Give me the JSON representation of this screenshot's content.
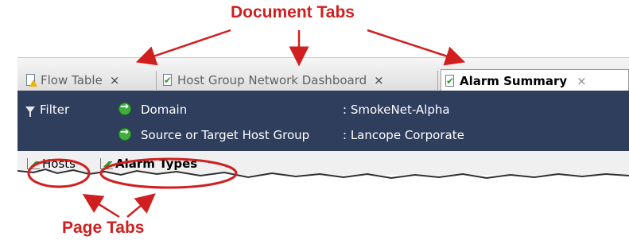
{
  "annotations": {
    "document_tabs": "Document Tabs",
    "page_tabs": "Page Tabs",
    "color": "#d01f1f"
  },
  "document_tabs": [
    {
      "label": "Flow Table",
      "icon": "document-warning-icon",
      "close": "×",
      "active": false
    },
    {
      "label": "Host Group Network Dashboard",
      "icon": "document-check-icon",
      "close": "×",
      "active": false
    },
    {
      "label": "Alarm Summary",
      "icon": "document-check-icon",
      "close": "×",
      "active": true
    }
  ],
  "filter": {
    "label": "Filter",
    "criteria": [
      {
        "name": "Domain",
        "value": ": SmokeNet-Alpha"
      },
      {
        "name": "Source or Target Host Group",
        "value": ": Lancope Corporate"
      }
    ],
    "background": "#2f3e5d"
  },
  "page_tabs": [
    {
      "label": "Hosts",
      "icon": "chart-icon",
      "active": false
    },
    {
      "label": "Alarm Types",
      "icon": "chart-icon",
      "active": true
    }
  ]
}
